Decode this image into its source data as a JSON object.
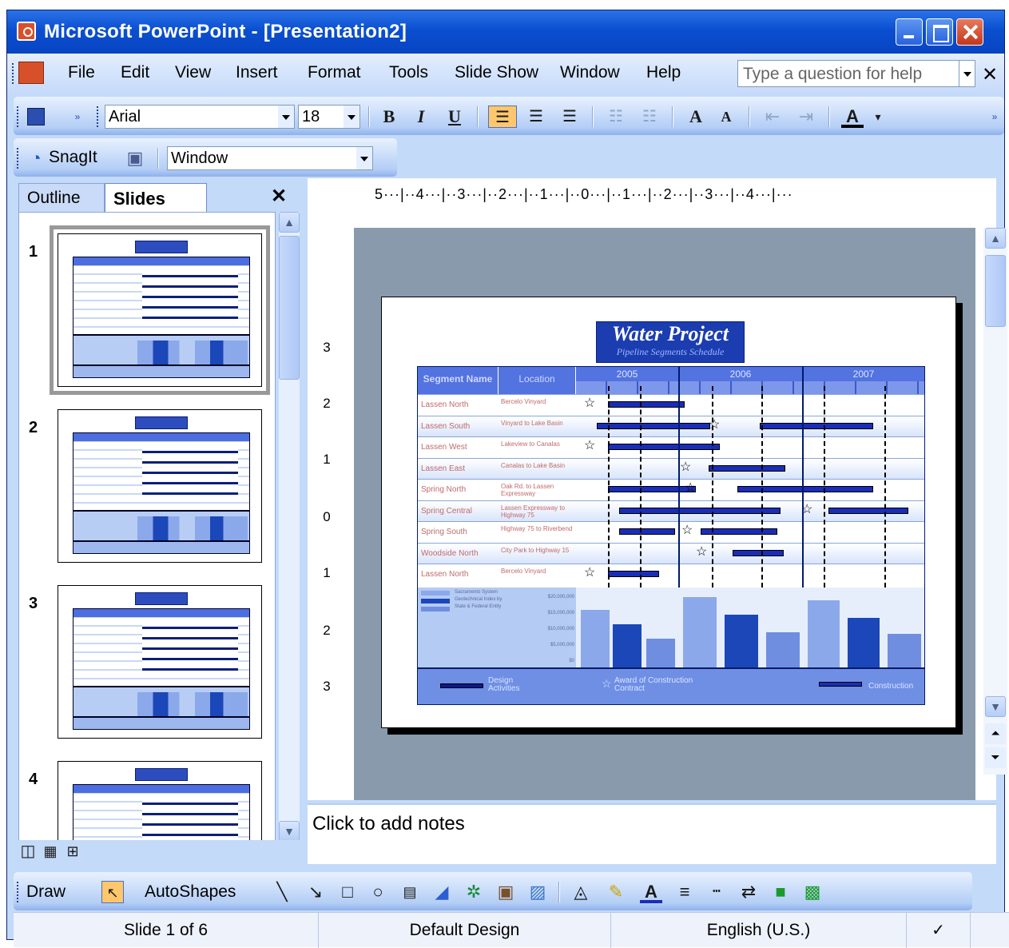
{
  "window": {
    "title": "Microsoft PowerPoint - [Presentation2]"
  },
  "menubar": {
    "items": [
      "File",
      "Edit",
      "View",
      "Insert",
      "Format",
      "Tools",
      "Slide Show",
      "Window",
      "Help"
    ],
    "help_placeholder": "Type a question for help"
  },
  "format_toolbar": {
    "font": "Arial",
    "size": "18"
  },
  "snagit_toolbar": {
    "label": "SnagIt",
    "capture_mode": "Window"
  },
  "left_pane": {
    "tabs": [
      "Outline",
      "Slides"
    ],
    "slide_numbers": [
      "1",
      "2",
      "3",
      "4"
    ]
  },
  "ruler": {
    "horizontal": "5···|··4···|··3···|··2···|··1···|··0···|··1···|··2···|··3···|··4···|···",
    "vertical": [
      "3",
      "2",
      "1",
      "0",
      "1",
      "2",
      "3"
    ]
  },
  "slide": {
    "title": "Water Project",
    "subtitle": "Pipeline Segments Schedule",
    "headers": [
      "Segment Name",
      "Location"
    ],
    "years": [
      "2005",
      "2006",
      "2007"
    ],
    "rows": [
      {
        "seg": "Lassen North",
        "loc": "Bercelo Vinyard"
      },
      {
        "seg": "Lassen South",
        "loc": "Vinyard to Lake Basin"
      },
      {
        "seg": "Lassen West",
        "loc": "Lakeview to Canalas"
      },
      {
        "seg": "Lassen East",
        "loc": "Canalas to Lake Basin"
      },
      {
        "seg": "Spring North",
        "loc": "Oak Rd. to Lassen Expressway"
      },
      {
        "seg": "Spring Central",
        "loc": "Lassen Expressway to Highway 75"
      },
      {
        "seg": "Spring South",
        "loc": "Highway 75 to Riverbend"
      },
      {
        "seg": "Woodside North",
        "loc": "City Park to Highway 15"
      },
      {
        "seg": "Lassen North",
        "loc": "Bercelo Vinyard"
      }
    ],
    "chart_legend": [
      "Sacramento System",
      "Geotechnical Index by",
      "State & Federal Entity"
    ],
    "chart_ticks": [
      "$20,000,000",
      "$15,000,000",
      "$10,000,000",
      "$5,000,000",
      "$0"
    ],
    "legend": {
      "design": "Design Activities",
      "award": "Award of Construction Contract",
      "construction": "Construction"
    }
  },
  "notes": {
    "placeholder": "Click to add notes"
  },
  "drawbar": {
    "draw": "Draw",
    "autoshapes": "AutoShapes"
  },
  "status": {
    "slide": "Slide 1 of 6",
    "design": "Default Design",
    "language": "English (U.S.)"
  }
}
